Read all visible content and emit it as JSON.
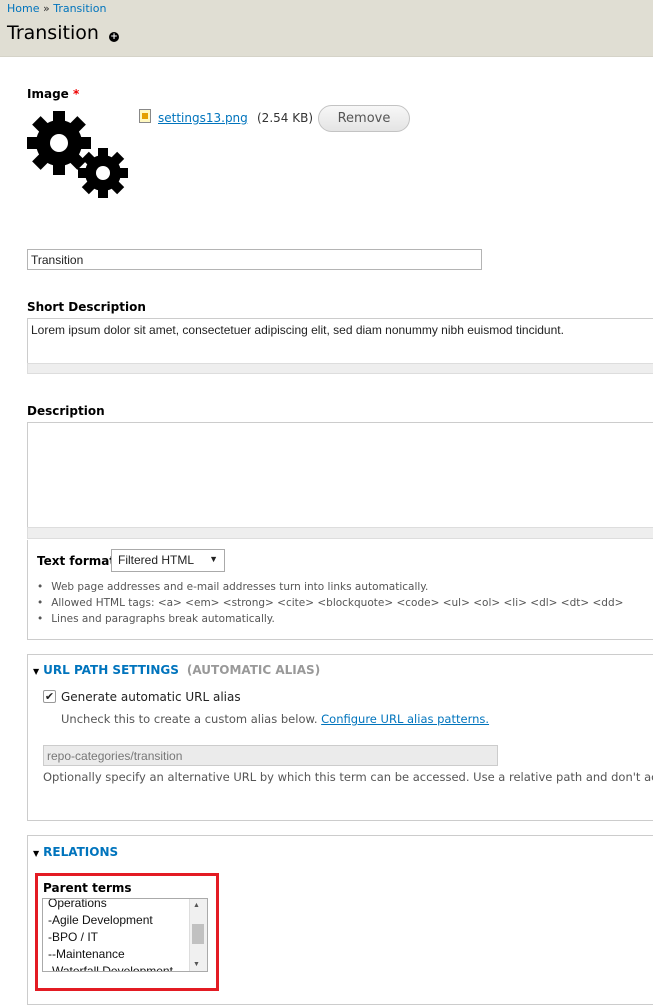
{
  "breadcrumb": {
    "home": "Home",
    "separator": "»",
    "current": "Transition"
  },
  "page": {
    "title": "Transition",
    "add_icon": "plus-circle-icon"
  },
  "image_field": {
    "label": "Image",
    "required_marker": "*",
    "file_name": "settings13.png",
    "file_size": "(2.54 KB)",
    "remove_label": "Remove",
    "preview_icon": "gears-icon"
  },
  "name_field": {
    "value": "Transition"
  },
  "short_description": {
    "label": "Short Description",
    "value": "Lorem ipsum dolor sit amet, consectetuer adipiscing elit, sed diam nonummy nibh euismod tincidunt."
  },
  "description": {
    "label": "Description",
    "value": "",
    "text_format_label": "Text format",
    "text_format_value": "Filtered HTML",
    "tips": [
      "Web page addresses and e-mail addresses turn into links automatically.",
      "Allowed HTML tags: <a> <em> <strong> <cite> <blockquote> <code> <ul> <ol> <li> <dl> <dt> <dd>",
      "Lines and paragraphs break automatically."
    ]
  },
  "url_path": {
    "legend": "URL PATH SETTINGS",
    "legend_suffix": "(AUTOMATIC ALIAS)",
    "checkbox_label": "Generate automatic URL alias",
    "checkbox_checked": true,
    "help_text": "Uncheck this to create a custom alias below.",
    "help_link": "Configure URL alias patterns.",
    "alias_value": "repo-categories/transition",
    "alias_description": "Optionally specify an alternative URL by which this term can be accessed. Use a relative path and don't ac"
  },
  "relations": {
    "legend": "RELATIONS",
    "parent_terms_label": "Parent terms",
    "options": [
      "Operations",
      "-Agile Development",
      "-BPO / IT",
      "--Maintenance",
      "-Waterfall Development"
    ]
  },
  "colors": {
    "link": "#0074bd",
    "header_bg": "#e0ded3",
    "highlight_box": "#e31b23",
    "required": "#ee0000"
  }
}
